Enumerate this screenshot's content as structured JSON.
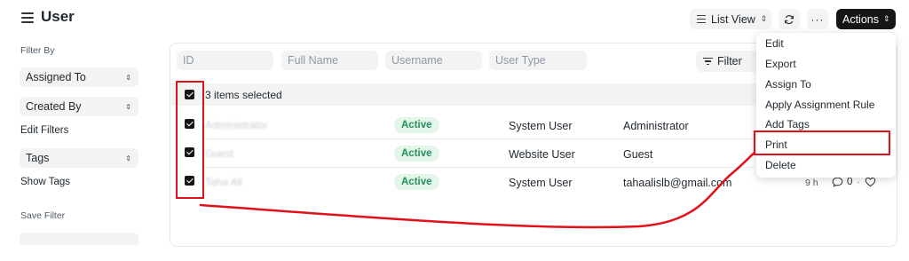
{
  "header": {
    "title": "User",
    "list_view_label": "List View",
    "more_label": "···",
    "actions_label": "Actions"
  },
  "sidebar": {
    "filter_by_label": "Filter By",
    "assigned_to": "Assigned To",
    "created_by": "Created By",
    "edit_filters": "Edit Filters",
    "tags": "Tags",
    "show_tags": "Show Tags",
    "save_filter": "Save Filter"
  },
  "filters": {
    "id_placeholder": "ID",
    "full_name_placeholder": "Full Name",
    "username_placeholder": "Username",
    "user_type_placeholder": "User Type",
    "filter_label": "Filter"
  },
  "selection": {
    "text": "3 items selected"
  },
  "rows": [
    {
      "name": "Administrator",
      "status": "Active",
      "user_type": "System User",
      "username": "Administrator"
    },
    {
      "name": "Guest",
      "status": "Active",
      "user_type": "Website User",
      "username": "Guest"
    },
    {
      "name": "Taha Ali",
      "status": "Active",
      "user_type": "System User",
      "username": "tahaalislb@gmail.com",
      "modified": "9 h",
      "comments": "0"
    }
  ],
  "actions_menu": {
    "items": [
      "Edit",
      "Export",
      "Assign To",
      "Apply Assignment Rule",
      "Add Tags",
      "Print",
      "Delete"
    ]
  },
  "colors": {
    "annotation_red": "#e0111b",
    "active_badge_bg": "#e4f5e9",
    "active_badge_text": "#278f5e",
    "primary_dark": "#171717"
  }
}
